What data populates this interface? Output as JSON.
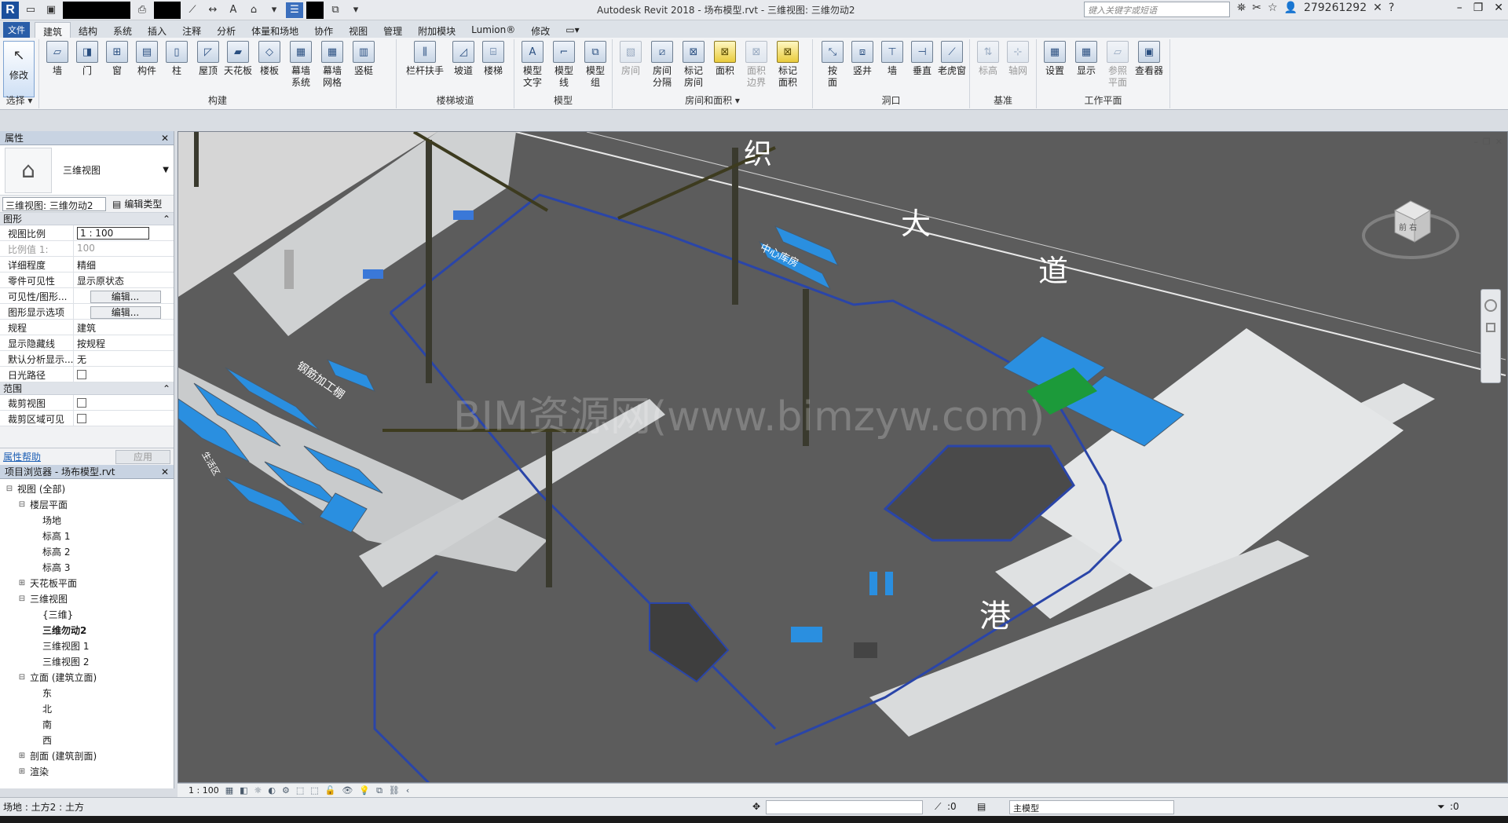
{
  "window": {
    "app_title": "Autodesk Revit 2018 -    场布模型.rvt - 三维视图: 三维勿动2",
    "search_placeholder": "键入关键字或短语",
    "user": "279261292"
  },
  "ribbon_tabs": [
    "文件",
    "建筑",
    "结构",
    "系统",
    "插入",
    "注释",
    "分析",
    "体量和场地",
    "协作",
    "视图",
    "管理",
    "附加模块",
    "Lumion®",
    "修改"
  ],
  "ribbon": {
    "modify_label": "修改",
    "select_label": "选择 ▾",
    "groups": {
      "build": "构建",
      "stairs": "楼梯坡道",
      "model": "模型",
      "room": "房间和面积 ▾",
      "opening": "洞口",
      "datum": "基准",
      "workplane": "工作平面"
    },
    "tools": {
      "wall": "墙",
      "door": "门",
      "window": "窗",
      "component": "构件",
      "column": "柱",
      "roof": "屋顶",
      "ceiling": "天花板",
      "floor": "楼板",
      "curtain_system": "幕墙\n系统",
      "curtain_grid": "幕墙\n网格",
      "mullion": "竖梃",
      "railing": "栏杆扶手",
      "ramp": "坡道",
      "stair": "楼梯",
      "model_text": "模型\n文字",
      "model_line": "模型\n线",
      "model_group": "模型\n组",
      "room": "房间",
      "room_sep": "房间\n分隔",
      "tag_room": "标记\n房间",
      "area": "面积",
      "area_boundary": "面积\n边界",
      "tag_area": "标记\n面积",
      "by_face": "按\n面",
      "shaft": "竖井",
      "wall_opening": "墙",
      "vertical": "垂直",
      "dormer": "老虎窗",
      "level": "标高",
      "grid": "轴网",
      "set": "设置",
      "show": "显示",
      "ref_plane": "参照\n平面",
      "viewer": "查看器"
    }
  },
  "properties": {
    "title": "属性",
    "type_name": "三维视图",
    "view_selector": "三维视图: 三维勿动2",
    "edit_type": "编辑类型",
    "sections": {
      "graphics": "图形",
      "extents": "范围"
    },
    "rows": [
      {
        "key": "视图比例",
        "value": "1 : 100"
      },
      {
        "key": "比例值 1:",
        "value": "100"
      },
      {
        "key": "详细程度",
        "value": "精细"
      },
      {
        "key": "零件可见性",
        "value": "显示原状态"
      },
      {
        "key": "可见性/图形...",
        "value": "编辑..."
      },
      {
        "key": "图形显示选项",
        "value": "编辑..."
      },
      {
        "key": "规程",
        "value": "建筑"
      },
      {
        "key": "显示隐藏线",
        "value": "按规程"
      },
      {
        "key": "默认分析显示...",
        "value": "无"
      },
      {
        "key": "日光路径",
        "value": ""
      }
    ],
    "extent_rows": [
      {
        "key": "裁剪视图",
        "value": ""
      },
      {
        "key": "裁剪区域可见",
        "value": ""
      }
    ],
    "help_link": "属性帮助",
    "apply": "应用"
  },
  "browser": {
    "title": "项目浏览器 - 场布模型.rvt",
    "items": [
      {
        "label": "视图 (全部)",
        "toggle": "⊟",
        "indent": 0
      },
      {
        "label": "楼层平面",
        "toggle": "⊟",
        "indent": 1
      },
      {
        "label": "场地",
        "toggle": "",
        "indent": 2
      },
      {
        "label": "标高 1",
        "toggle": "",
        "indent": 2
      },
      {
        "label": "标高 2",
        "toggle": "",
        "indent": 2
      },
      {
        "label": "标高 3",
        "toggle": "",
        "indent": 2
      },
      {
        "label": "天花板平面",
        "toggle": "⊞",
        "indent": 1
      },
      {
        "label": "三维视图",
        "toggle": "⊟",
        "indent": 1
      },
      {
        "label": "{三维}",
        "toggle": "",
        "indent": 2
      },
      {
        "label": "三维勿动2",
        "toggle": "",
        "indent": 2,
        "bold": true
      },
      {
        "label": "三维视图 1",
        "toggle": "",
        "indent": 2
      },
      {
        "label": "三维视图 2",
        "toggle": "",
        "indent": 2
      },
      {
        "label": "立面 (建筑立面)",
        "toggle": "⊟",
        "indent": 1
      },
      {
        "label": "东",
        "toggle": "",
        "indent": 2
      },
      {
        "label": "北",
        "toggle": "",
        "indent": 2
      },
      {
        "label": "南",
        "toggle": "",
        "indent": 2
      },
      {
        "label": "西",
        "toggle": "",
        "indent": 2
      },
      {
        "label": "剖面 (建筑剖面)",
        "toggle": "⊞",
        "indent": 1
      },
      {
        "label": "渲染",
        "toggle": "⊞",
        "indent": 1
      }
    ]
  },
  "viewport": {
    "watermark": "BIM资源网(www.bimzyw.com)",
    "road_labels": [
      "织",
      "大",
      "道",
      "港"
    ],
    "building_labels": {
      "center_warehouse": "中心库房",
      "rebar_shop": "钢筋加工棚",
      "worker_zone": "生活区"
    },
    "viewcube_label": "前 右"
  },
  "view_bar": {
    "scale": "1 : 100"
  },
  "status": {
    "left": "场地 : 土方2 : 土方",
    "coord": ":0",
    "model": "主模型",
    "filter": ":0"
  }
}
